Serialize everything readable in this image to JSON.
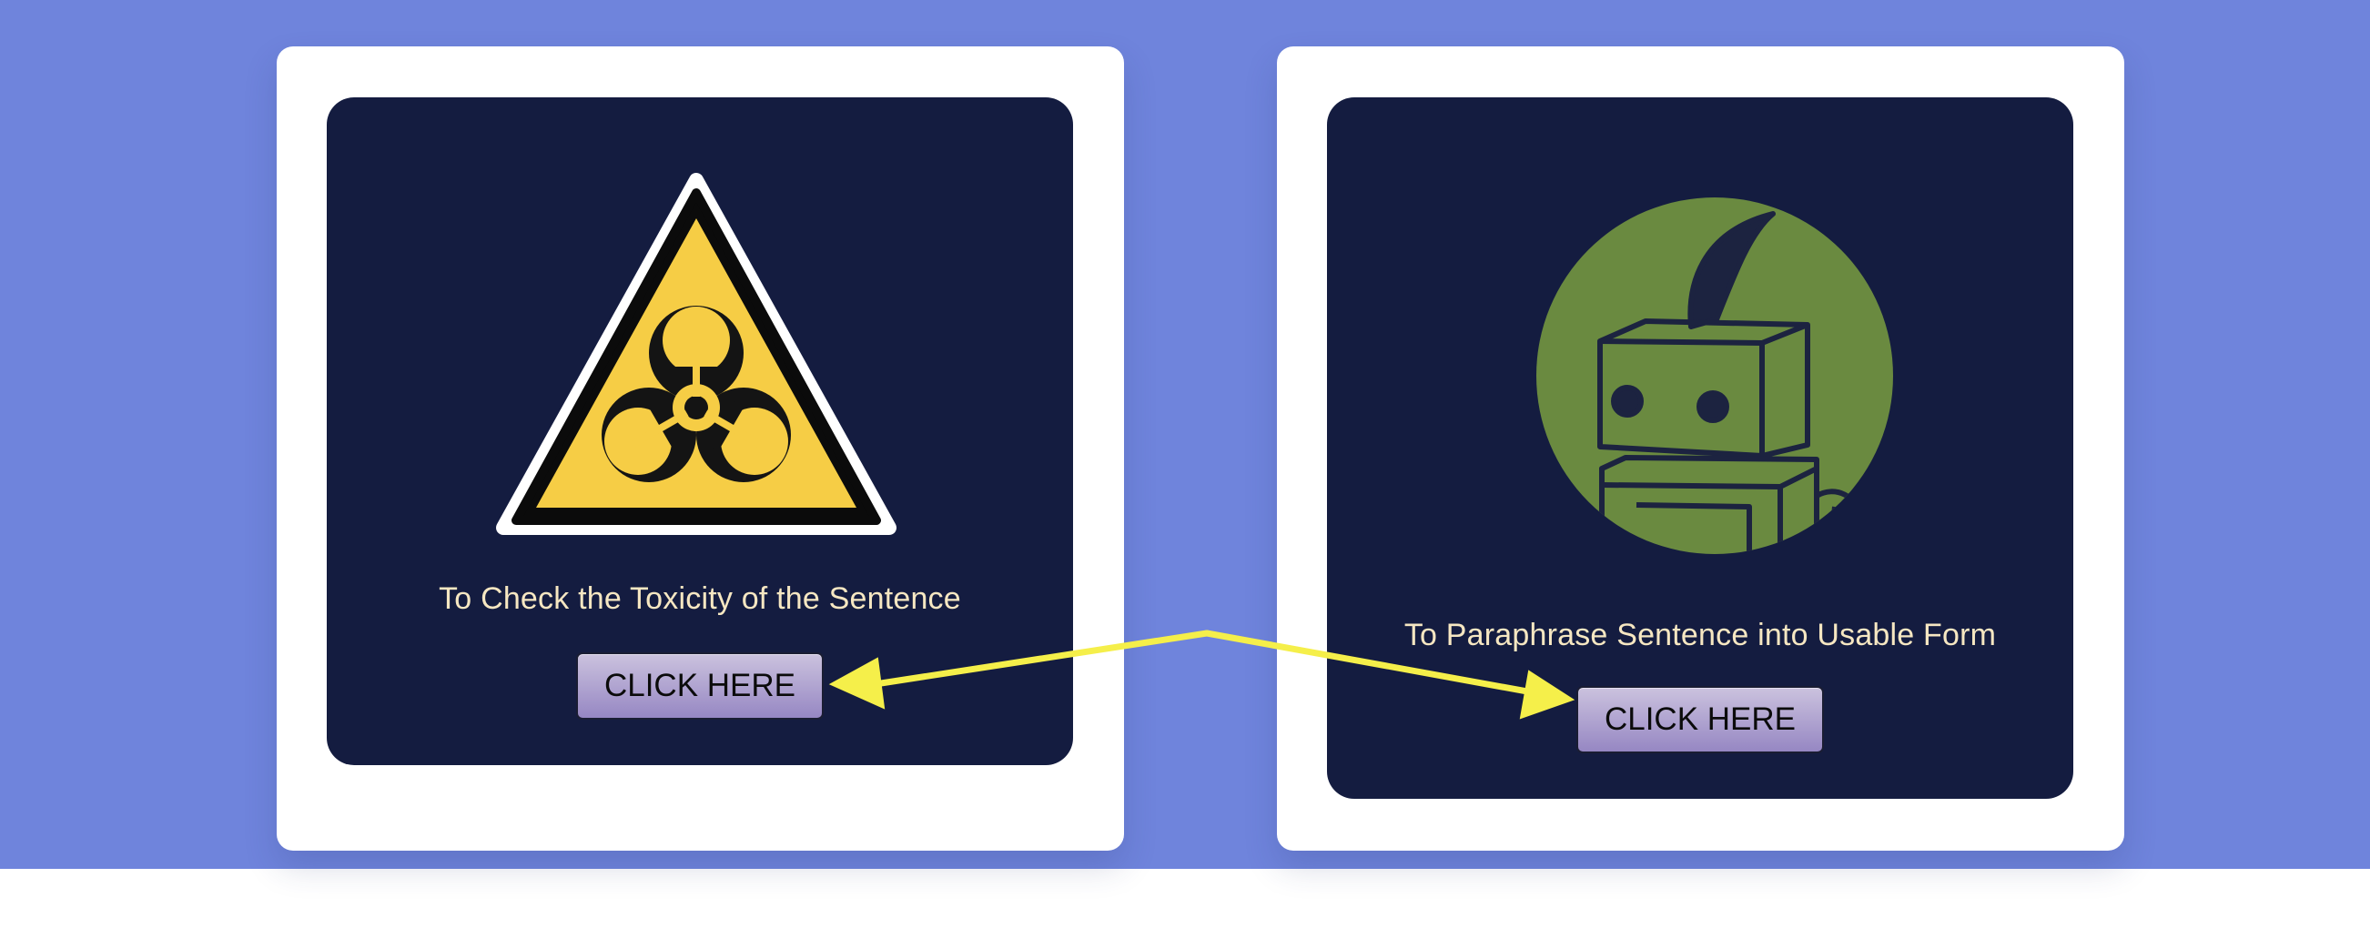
{
  "colors": {
    "page_background": "#6f84dc",
    "card_background": "#ffffff",
    "panel_background": "#141c40",
    "caption_text": "#f6e7c2",
    "annotation_arrow": "#f5ef4a",
    "robot_circle": "#6a8a40"
  },
  "cards": [
    {
      "icon": "biohazard-warning-icon",
      "caption": "To Check the Toxicity of the Sentence",
      "button_label": "CLICK HERE"
    },
    {
      "icon": "robot-quill-icon",
      "caption": "To Paraphrase Sentence into Usable Form",
      "button_label": "CLICK HERE"
    }
  ]
}
